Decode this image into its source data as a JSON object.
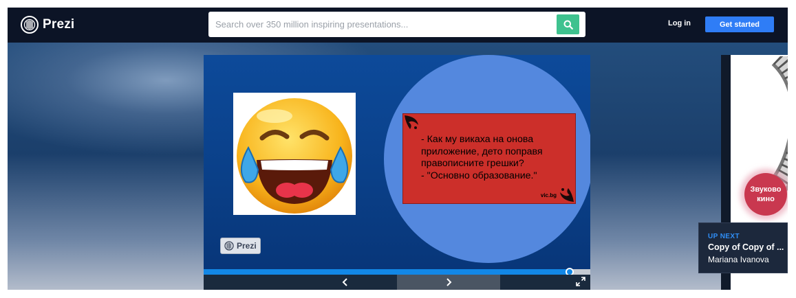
{
  "header": {
    "brand": "Prezi",
    "search_placeholder": "Search over 350 million inspiring presentations...",
    "login_label": "Log in",
    "get_started_label": "Get started"
  },
  "slide": {
    "quote_text": "- Как му викаха на онова\nприложение, дето поправя\nправописните грешки?\n- \"Основно образование.\"",
    "quote_signature": "vic.bg",
    "watermark_text": "Prezi",
    "progress_fraction": 0.947
  },
  "next_thumbnail": {
    "badge_text": "Звуково кино"
  },
  "up_next": {
    "label": "UP NEXT",
    "title": "Copy of Copy of ...",
    "author": "Mariana Ivanova"
  },
  "icons": {
    "logo": "prezi-logo-icon",
    "search": "search-icon",
    "prev": "chevron-left-icon",
    "next": "chevron-right-icon",
    "fullscreen": "fullscreen-icon"
  },
  "colors": {
    "header_bg": "#0c1426",
    "search_button": "#3ec28f",
    "get_started": "#2f7df6",
    "slide_bg": "#0d4a9a",
    "circle": "#5488de",
    "quote_bg": "#cc2f2a",
    "progress": "#1287e6",
    "up_next_label": "#2f8ef6"
  }
}
